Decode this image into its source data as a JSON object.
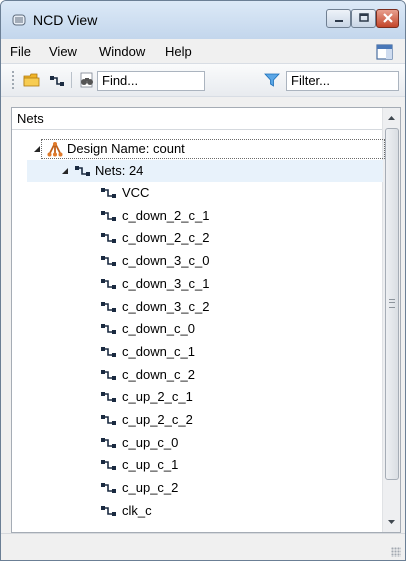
{
  "window": {
    "title": "NCD View"
  },
  "menu": {
    "items": [
      "File",
      "View",
      "Window",
      "Help"
    ]
  },
  "toolbar": {
    "find_placeholder": "Find...",
    "filter_placeholder": "Filter..."
  },
  "panel": {
    "header": "Nets"
  },
  "tree": {
    "root_label": "Design Name: count",
    "nets_label": "Nets: 24",
    "nets": [
      "VCC",
      "c_down_2_c_1",
      "c_down_2_c_2",
      "c_down_3_c_0",
      "c_down_3_c_1",
      "c_down_3_c_2",
      "c_down_c_0",
      "c_down_c_1",
      "c_down_c_2",
      "c_up_2_c_1",
      "c_up_2_c_2",
      "c_up_c_0",
      "c_up_c_1",
      "c_up_c_2",
      "clk_c"
    ]
  },
  "colors": {
    "root_icon": "#c0601a",
    "filter_icon": "#2a8ad8",
    "folder_icon": "#f0b428",
    "close_button": "#c3452a"
  }
}
